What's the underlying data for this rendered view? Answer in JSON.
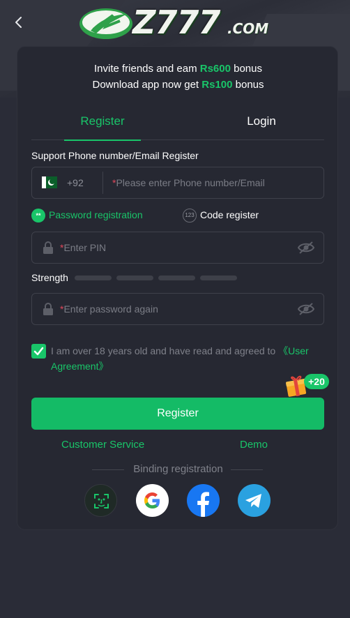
{
  "header": {
    "back_label": "",
    "logo_text": "Z777",
    "logo_suffix": ".COM"
  },
  "promo": {
    "line1_pre": "Invite friends and eam ",
    "line1_amount": "Rs600",
    "line1_post": " bonus",
    "line2_pre": "Download app now get ",
    "line2_amount": "Rs100",
    "line2_post": " bonus"
  },
  "tabs": [
    {
      "label": "Register",
      "active": true
    },
    {
      "label": "Login",
      "active": false
    }
  ],
  "form": {
    "phone_label": "Support Phone number/Email Register",
    "country_code": "+92",
    "phone_placeholder": "Please enter Phone number/Email",
    "required_mark": "*",
    "option_password": "Password registration",
    "option_password_icon_text": "**",
    "option_code": "Code register",
    "option_code_icon_text": "123",
    "pin_placeholder": "Enter PIN",
    "strength_label": "Strength",
    "strength_level": 0,
    "confirm_placeholder": "Enter password again",
    "agreement_checked": true,
    "agreement_text": "I am over 18 years old and have read and agreed to ",
    "agreement_link": "《User Agreement》",
    "bonus_badge": "+20",
    "register_button": "Register"
  },
  "links": {
    "customer_service": "Customer Service",
    "demo": "Demo"
  },
  "binding": {
    "label": "Binding registration",
    "providers": [
      "face-id",
      "google",
      "facebook",
      "telegram"
    ]
  },
  "colors": {
    "accent": "#19c569",
    "background": "#2a2c37",
    "card": "#262832",
    "required": "#e0475a"
  }
}
